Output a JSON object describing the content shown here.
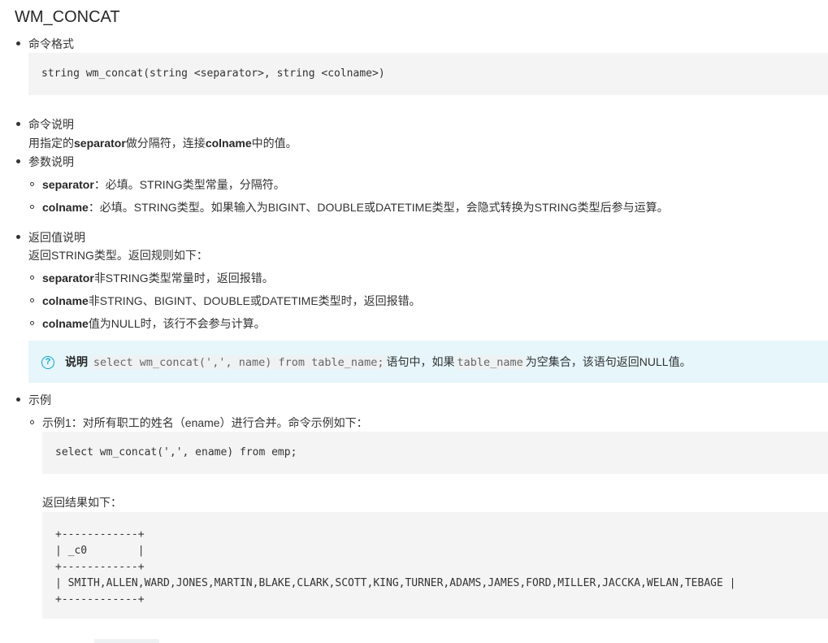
{
  "title": "WM_CONCAT",
  "cmd_format_label": "命令格式",
  "cmd_format_code": "string wm_concat(string <separator>, string <colname>)",
  "cmd_desc_label": "命令说明",
  "cmd_desc": {
    "pre": "用指定的",
    "b1": "separator",
    "mid": "做分隔符，连接",
    "b2": "colname",
    "post": "中的值。"
  },
  "params_label": "参数说明",
  "params": [
    {
      "name": "separator",
      "desc": "：必填。STRING类型常量，分隔符。"
    },
    {
      "name": "colname",
      "desc": "：必填。STRING类型。如果输入为BIGINT、DOUBLE或DATETIME类型，会隐式转换为STRING类型后参与运算。"
    }
  ],
  "return_label": "返回值说明",
  "return_intro": "返回STRING类型。返回规则如下：",
  "return_rules": [
    {
      "name": "separator",
      "desc": "非STRING类型常量时，返回报错。"
    },
    {
      "name": "colname",
      "desc": "非STRING、BIGINT、DOUBLE或DATETIME类型时，返回报错。"
    },
    {
      "name": "colname",
      "desc": "值为NULL时，该行不会参与计算。"
    }
  ],
  "note": {
    "icon": "question-circle-icon",
    "label": "说明",
    "code1": "select wm_concat(',', name) from table_name;",
    "text1": "语句中，如果",
    "code2": "table_name",
    "text2": "为空集合，该语句返回NULL值。"
  },
  "example_label": "示例",
  "example1_text": "示例1：对所有职工的姓名（ename）进行合并。命令示例如下：",
  "example1_code": "select wm_concat(',', ename) from emp;",
  "result_label": "返回结果如下：",
  "result_lines": [
    "+------------+",
    "| _c0        |",
    "+------------+",
    "| SMITH,ALLEN,WARD,JONES,MARTIN,BLAKE,CLARK,SCOTT,KING,TURNER,ADAMS,JAMES,FORD,MILLER,JACCKA,WELAN,TEBAGE |",
    "+------------+"
  ],
  "colors": {
    "note_bg": "#e6f6fb",
    "icon": "#0aa5c9",
    "code_bg": "#f4f4f4"
  }
}
